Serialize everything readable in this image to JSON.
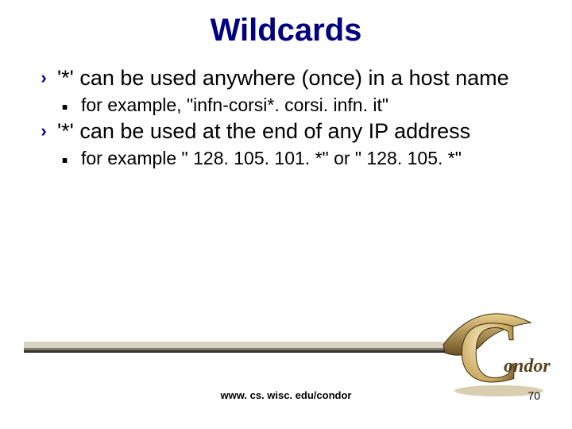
{
  "title": "Wildcards",
  "bullets": {
    "b1": "'*' can be used anywhere (once) in a host name",
    "b1a": "for example, \"infn-corsi*. corsi. infn. it\"",
    "b2": "'*' can be used at the end of any IP address",
    "b2a": "for example \" 128. 105. 101. *\" or \" 128. 105. *\""
  },
  "footer": {
    "url": "www. cs. wisc. edu/condor",
    "page": "70"
  },
  "logo": {
    "text": "ondor",
    "big_letter": "C"
  }
}
